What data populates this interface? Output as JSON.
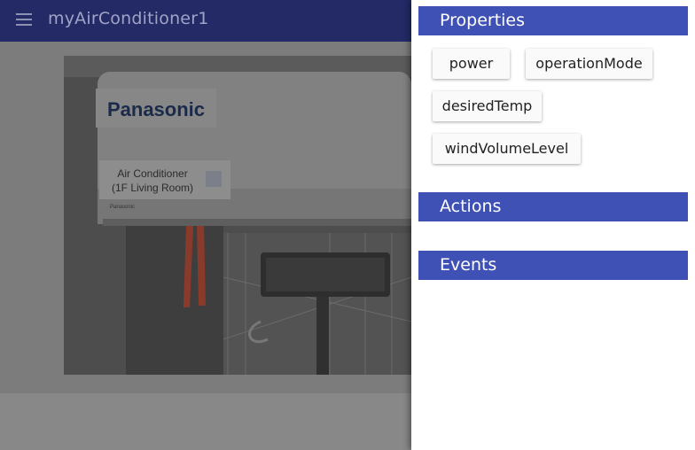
{
  "header": {
    "title": "myAirConditioner1",
    "menu_icon": "menu-icon"
  },
  "photo": {
    "brand_label": "Panasonic",
    "card_line1": "Air Conditioner",
    "card_line2": "(1F Living Room)",
    "small_brand": "Panasonic"
  },
  "drawer": {
    "properties": {
      "title": "Properties",
      "items": [
        "power",
        "operationMode",
        "desiredTemp",
        "windVolumeLevel"
      ]
    },
    "actions": {
      "title": "Actions"
    },
    "events": {
      "title": "Events"
    }
  },
  "colors": {
    "appbar": "#232a66",
    "section_header": "#3f51b5",
    "drawer_bg": "#ffffff"
  }
}
